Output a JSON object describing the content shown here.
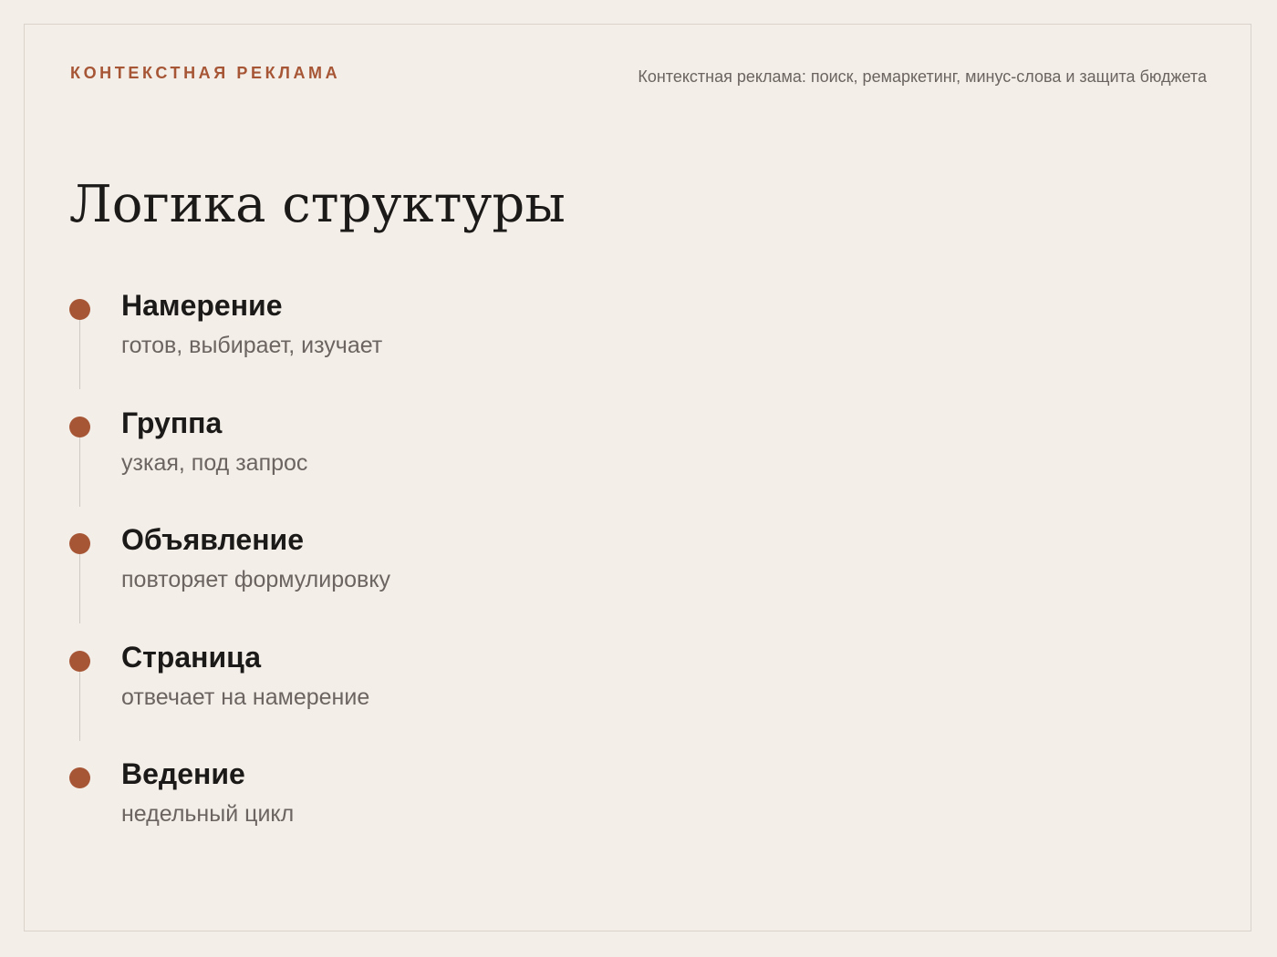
{
  "header": {
    "eyebrow": "КОНТЕКСТНАЯ РЕКЛАМА",
    "subtitle": "Контекстная реклама: поиск, ремаркетинг, минус-слова и защита бюджета"
  },
  "title": "Логика структуры",
  "accent_color": "#a65535",
  "steps": [
    {
      "title": "Намерение",
      "desc": "готов, выбирает, изучает"
    },
    {
      "title": "Группа",
      "desc": "узкая, под запрос"
    },
    {
      "title": "Объявление",
      "desc": "повторяет формулировку"
    },
    {
      "title": "Страница",
      "desc": "отвечает на намерение"
    },
    {
      "title": "Ведение",
      "desc": "недельный цикл"
    }
  ]
}
